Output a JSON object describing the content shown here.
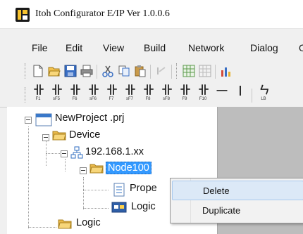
{
  "window": {
    "title": "Itoh Configurator E/IP Ver 1.0.0.6"
  },
  "menu": {
    "items": [
      "File",
      "Edit",
      "View",
      "Build",
      "Network",
      "Dialog",
      "O"
    ]
  },
  "toolbar": {
    "icons": [
      "new-icon",
      "open-icon",
      "save-icon",
      "print-icon",
      "cut-icon",
      "copy-icon",
      "paste-icon",
      "undo-icon",
      "grid-icon",
      "grid2-icon",
      "chart-icon"
    ]
  },
  "function_keys": [
    {
      "glyph": "卝",
      "label": "F1"
    },
    {
      "glyph": "卝",
      "label": "sF5"
    },
    {
      "glyph": "卝",
      "label": "F6"
    },
    {
      "glyph": "卝",
      "label": "sF6"
    },
    {
      "glyph": "卝",
      "label": "F7"
    },
    {
      "glyph": "卝",
      "label": "sF7"
    },
    {
      "glyph": "卝",
      "label": "F8"
    },
    {
      "glyph": "卝",
      "label": "sF8"
    },
    {
      "glyph": "卝",
      "label": "F9"
    },
    {
      "glyph": "卝",
      "label": "F10"
    },
    {
      "glyph": "—",
      "label": ""
    },
    {
      "glyph": "|",
      "label": ""
    },
    {
      "glyph": "ㄣ",
      "label": "LB"
    }
  ],
  "tree": {
    "project": "NewProject .prj",
    "device": "Device",
    "ip": "192.168.1.xx",
    "node": "Node100",
    "properties": "Prope",
    "logic_child": "Logic",
    "logic": "Logic"
  },
  "context_menu": {
    "items": [
      "Delete",
      "Duplicate"
    ],
    "highlighted": "Delete"
  }
}
